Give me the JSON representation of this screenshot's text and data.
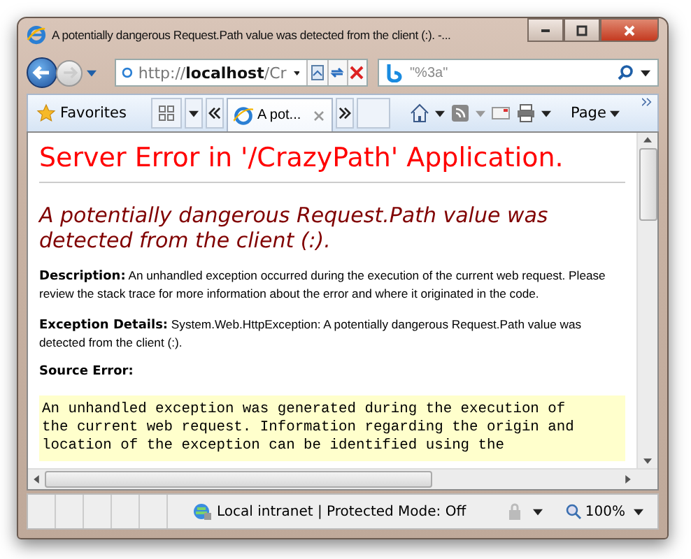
{
  "window": {
    "title": "A potentially dangerous Request.Path value was detected from the client (:). -..."
  },
  "nav": {
    "address": "http://**localhost**/Cr",
    "search": "\"%3a\""
  },
  "toolbar": {
    "favorites": "Favorites",
    "tab": {
      "label": "A pot...",
      "selected": true
    },
    "page_menu": "Page"
  },
  "content": {
    "heading": "Server Error in '/CrazyPath' Application.",
    "subheading": "A potentially dangerous Request.Path value was detected from the client (:).",
    "sections": [
      {
        "label": "Description:",
        "text": "An unhandled exception occurred during the execution of the current web request. Please review the stack trace for more information about the error and where it originated in the code."
      },
      {
        "label": "Exception Details:",
        "text": "System.Web.HttpException: A potentially dangerous Request.Path value was detected from the client (:)."
      }
    ],
    "source_label": "Source Error:",
    "source_lines": [
      "An unhandled exception was generated during the execution of",
      "the current web request. Information regarding the origin and",
      "location of the exception can be identified using the"
    ]
  },
  "status_bar": {
    "zone": "Local intranet | Protected Mode: Off",
    "zoom": "100%"
  }
}
